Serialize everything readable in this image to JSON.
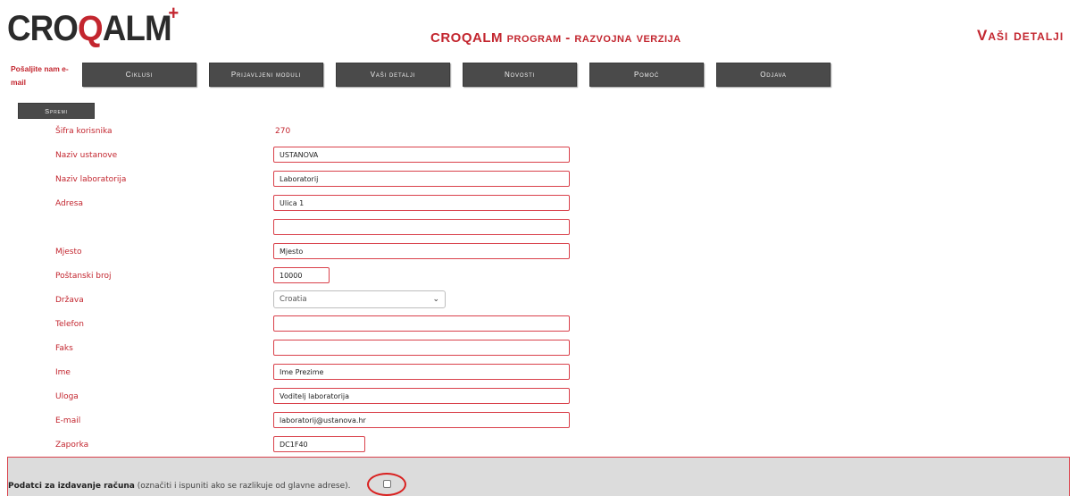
{
  "header": {
    "logo_prefix": "CRO",
    "logo_q": "Q",
    "logo_suffix": "ALM",
    "logo_plus": "+",
    "program_title": "CROQALM program - razvojna verzija",
    "page_heading": "Vaši detalji",
    "email_link": "Pošaljite nam e-mail"
  },
  "nav": [
    {
      "label": "Ciklusi"
    },
    {
      "label": "Prijavljeni moduli"
    },
    {
      "label": "Vaši detalji"
    },
    {
      "label": "Novosti"
    },
    {
      "label": "Pomoć"
    },
    {
      "label": "Odjava"
    }
  ],
  "form": {
    "save_label": "Spremi",
    "user_id_label": "Šifra korisnika",
    "user_id_value": "270",
    "institution_label": "Naziv ustanove",
    "institution_value": "USTANOVA",
    "lab_label": "Naziv laboratorija",
    "lab_value": "Laboratorij",
    "address_label": "Adresa",
    "address1_value": "Ulica 1",
    "address2_value": "",
    "city_label": "Mjesto",
    "city_value": "Mjesto",
    "postal_label": "Poštanski broj",
    "postal_value": "10000",
    "country_label": "Država",
    "country_value": "Croatia",
    "phone_label": "Telefon",
    "phone_value": "",
    "fax_label": "Faks",
    "fax_value": "",
    "name_label": "Ime",
    "name_value": "Ime Prezime",
    "role_label": "Uloga",
    "role_value": "Voditelj laboratorija",
    "email_label": "E-mail",
    "email_value": "laboratorij@ustanova.hr",
    "password_label": "Zaporka",
    "password_value": "DC1F40"
  },
  "billing": {
    "title": "Podatci za izdavanje računa",
    "note": "(označiti i ispuniti ako se razlikuje od glavne adrese)."
  },
  "colors": {
    "accent": "#c3262f",
    "nav_bg": "#4a4a4a",
    "billing_bg": "#dcdcdc"
  }
}
